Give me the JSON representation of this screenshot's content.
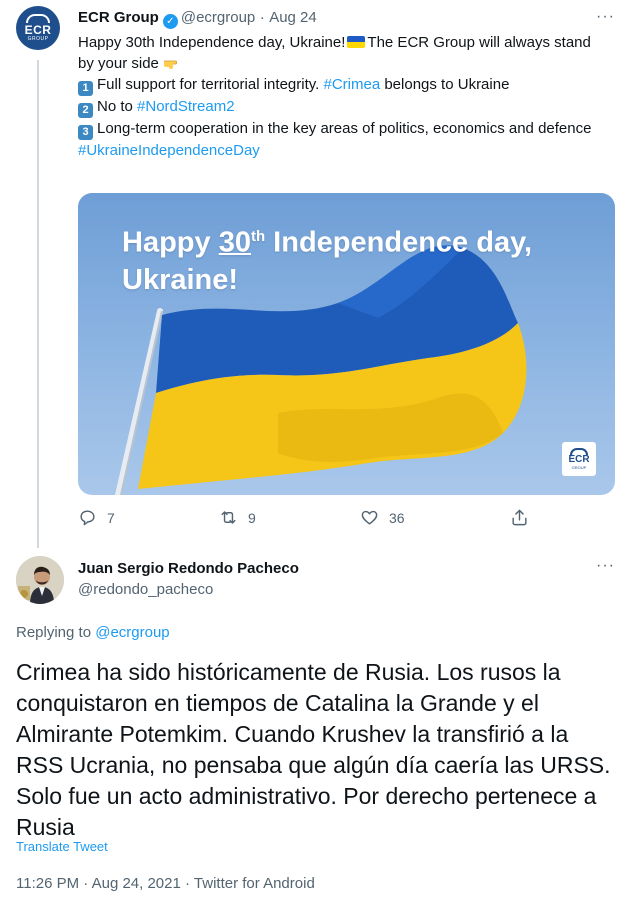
{
  "tweet": {
    "author_name": "ECR Group",
    "author_handle": "@ecrgroup",
    "separator": "·",
    "date": "Aug 24",
    "more": "···",
    "avatar_text": "ECR",
    "avatar_subtext": "GROUP",
    "line1": "Happy 30th Independence day, Ukraine!",
    "line1b": "The ECR Group will always stand by your side",
    "item1_num": "1",
    "item1_text": "Full support for territorial integrity.",
    "item1_link": "#Crimea",
    "item1_tail": "belongs to Ukraine",
    "item2_num": "2",
    "item2_text": "No to",
    "item2_link": "#NordStream2",
    "item3_num": "3",
    "item3_text": "Long-term cooperation in the key areas of politics, economics and defence",
    "hashtag": "#UkraineIndependenceDay",
    "media": {
      "title_a": "Happy ",
      "title_num": "30",
      "title_sup": "th",
      "title_b": " Independence day,",
      "title_line2": "Ukraine!",
      "badge_text": "ECR",
      "badge_subtext": "GROUP"
    },
    "actions": {
      "reply_count": "7",
      "retweet_count": "9",
      "like_count": "36"
    },
    "colors": {
      "accent": "#1d9bf0",
      "muted": "#536471",
      "ecr_blue": "#1f4e8c"
    }
  },
  "reply": {
    "author_name": "Juan Sergio Redondo Pacheco",
    "author_handle": "@redondo_pacheco",
    "more": "···",
    "replying_prefix": "Replying to",
    "replying_to": "@ecrgroup",
    "text": "Crimea ha sido históricamente de Rusia. Los rusos la conquistaron en tiempos de Catalina la Grande y el Almirante Potemkim. Cuando Krushev la transfirió a la RSS Ucrania, no pensaba que algún día caería las URSS. Solo fue un acto administrativo. Por derecho pertenece a Rusia",
    "translate": "Translate Tweet",
    "meta": "11:26 PM · Aug 24, 2021 · Twitter for Android"
  }
}
